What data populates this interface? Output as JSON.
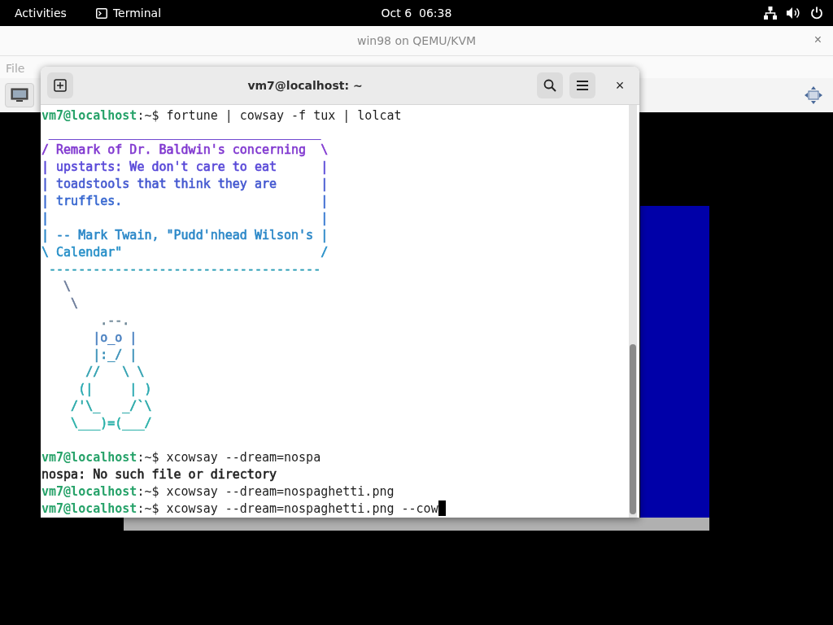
{
  "top_bar": {
    "activities": "Activities",
    "app": "Terminal",
    "clock": "Oct 6  06:38"
  },
  "vm_window": {
    "title": "win98 on QEMU/KVM",
    "close": "×",
    "menu": [
      "File"
    ]
  },
  "terminal": {
    "title": "vm7@localhost: ~",
    "close": "×",
    "lines": [
      {
        "kind": "prompt",
        "user": "vm7@localhost",
        "path": ":~$ ",
        "command": "fortune | cowsay -f tux | lolcat",
        "cursor": false
      },
      {
        "kind": "output",
        "text": " _____________________________________",
        "color": "#7048d0"
      },
      {
        "kind": "output",
        "text": "/ Remark of Dr. Baldwin's concerning  \\",
        "color": "#8038d0"
      },
      {
        "kind": "output",
        "text": "| upstarts: We don't care to eat      |",
        "color": "#5848d8"
      },
      {
        "kind": "output",
        "text": "| toadstools that think they are      |",
        "color": "#4458d0"
      },
      {
        "kind": "output",
        "text": "| truffles.                           |",
        "color": "#3868d0"
      },
      {
        "kind": "output",
        "text": "|                                     |",
        "color": "#3478d0"
      },
      {
        "kind": "output",
        "text": "| -- Mark Twain, \"Pudd'nhead Wilson's |",
        "color": "#2c88c8"
      },
      {
        "kind": "output",
        "text": "\\ Calendar\"                           /",
        "color": "#2890c8"
      },
      {
        "kind": "output",
        "text": " -------------------------------------",
        "color": "#30a0b8"
      },
      {
        "kind": "output",
        "text": "   \\",
        "color": "#6a7a98"
      },
      {
        "kind": "output",
        "text": "    \\",
        "color": "#6a7a98"
      },
      {
        "kind": "output",
        "text": "        .--.",
        "color": "#708898"
      },
      {
        "kind": "output",
        "text": "       |o_o |",
        "color": "#4a80c0"
      },
      {
        "kind": "output",
        "text": "       |:_/ |",
        "color": "#3a90b8"
      },
      {
        "kind": "output",
        "text": "      //   \\ \\",
        "color": "#30a0b0"
      },
      {
        "kind": "output",
        "text": "     (|     | )",
        "color": "#28a8b0"
      },
      {
        "kind": "output",
        "text": "    /'\\_   _/`\\",
        "color": "#28a8a8"
      },
      {
        "kind": "output",
        "text": "    \\___)=(___/",
        "color": "#28b0a8"
      },
      {
        "kind": "blank"
      },
      {
        "kind": "prompt",
        "user": "vm7@localhost",
        "path": ":~$ ",
        "command": "xcowsay --dream=nospa",
        "cursor": false
      },
      {
        "kind": "output",
        "text": "nospa: No such file or directory",
        "color": "#1e1e1e"
      },
      {
        "kind": "prompt",
        "user": "vm7@localhost",
        "path": ":~$ ",
        "command": "xcowsay --dream=nospaghetti.png",
        "cursor": false
      },
      {
        "kind": "prompt",
        "user": "vm7@localhost",
        "path": ":~$ ",
        "command": "xcowsay --dream=nospaghetti.png --cow",
        "cursor": true
      }
    ]
  }
}
